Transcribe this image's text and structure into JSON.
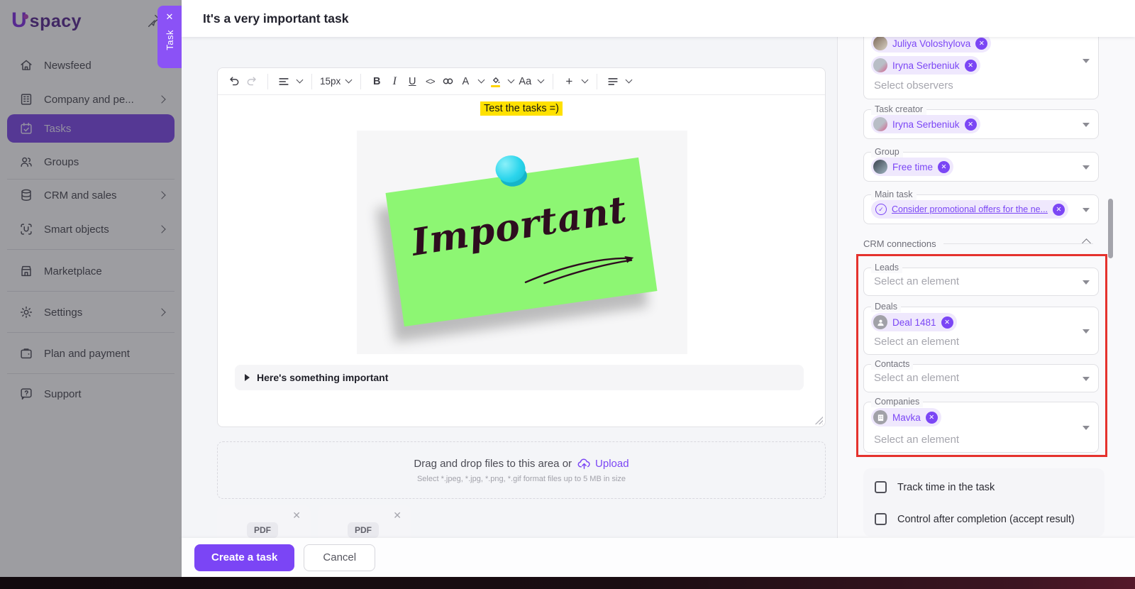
{
  "sidebar": {
    "logo_mark": "U",
    "logo_text": "spacy",
    "items": [
      {
        "label": "Newsfeed",
        "icon": "home-icon",
        "has_chevron": false,
        "active": false
      },
      {
        "label": "Company and pe...",
        "icon": "building-icon",
        "has_chevron": true,
        "active": false
      },
      {
        "label": "Tasks",
        "icon": "calendar-check-icon",
        "has_chevron": false,
        "active": true
      },
      {
        "label": "Groups",
        "icon": "people-icon",
        "has_chevron": false,
        "active": false
      },
      {
        "label": "CRM and sales",
        "icon": "database-icon",
        "has_chevron": true,
        "active": false
      },
      {
        "label": "Smart objects",
        "icon": "smart-object-icon",
        "has_chevron": true,
        "active": false
      },
      {
        "label": "Marketplace",
        "icon": "storefront-icon",
        "has_chevron": false,
        "active": false
      },
      {
        "label": "Settings",
        "icon": "gear-icon",
        "has_chevron": true,
        "active": false
      },
      {
        "label": "Plan and payment",
        "icon": "wallet-icon",
        "has_chevron": false,
        "active": false
      },
      {
        "label": "Support",
        "icon": "help-icon",
        "has_chevron": false,
        "active": false
      }
    ]
  },
  "task_tab": {
    "label": "Task",
    "close_glyph": "✕"
  },
  "header": {
    "title": "It's a very important task"
  },
  "editor": {
    "toolbar": {
      "font_size": "15px",
      "bold": "B",
      "italic": "I",
      "underline": "U",
      "code": "<>",
      "text_color": "A",
      "text_style": "Aa",
      "insert": "+"
    },
    "highlighted_text": "Test the tasks =)",
    "note_word": "Important",
    "spoiler_title": "Here's something important"
  },
  "dropzone": {
    "prompt": "Drag and drop files to this area or",
    "upload_label": "Upload",
    "hint": "Select *.jpeg, *.jpg, *.png, *.gif format files up to 5 MB in size"
  },
  "attachments": [
    {
      "label": "PDF"
    },
    {
      "label": "PDF"
    }
  ],
  "footer": {
    "create_label": "Create a task",
    "cancel_label": "Cancel"
  },
  "panel": {
    "observers": {
      "placeholder": "Select observers",
      "chips": [
        {
          "name": "Juliya Voloshylova"
        },
        {
          "name": "Iryna Serbeniuk"
        }
      ]
    },
    "task_creator": {
      "label": "Task creator",
      "chip": {
        "name": "Iryna Serbeniuk"
      }
    },
    "group": {
      "label": "Group",
      "chip": {
        "name": "Free time"
      }
    },
    "main_task": {
      "label": "Main task",
      "chip": {
        "name": "Consider promotional offers for the ne..."
      }
    },
    "crm_section_label": "CRM connections",
    "leads": {
      "label": "Leads",
      "placeholder": "Select an element"
    },
    "deals": {
      "label": "Deals",
      "placeholder": "Select an element",
      "chip": {
        "name": "Deal 1481"
      }
    },
    "contacts": {
      "label": "Contacts",
      "placeholder": "Select an element"
    },
    "companies": {
      "label": "Companies",
      "placeholder": "Select an element",
      "chip": {
        "name": "Mavka"
      }
    },
    "checkboxes": [
      {
        "label": "Track time in the task",
        "checked": false
      },
      {
        "label": "Control after completion (accept result)",
        "checked": false
      }
    ]
  },
  "colors": {
    "accent": "#7B46F5",
    "highlight_yellow": "#FFE100",
    "attention_red": "#E5322D",
    "note_green": "#8DF673",
    "pin_cyan": "#2BD5EC"
  }
}
